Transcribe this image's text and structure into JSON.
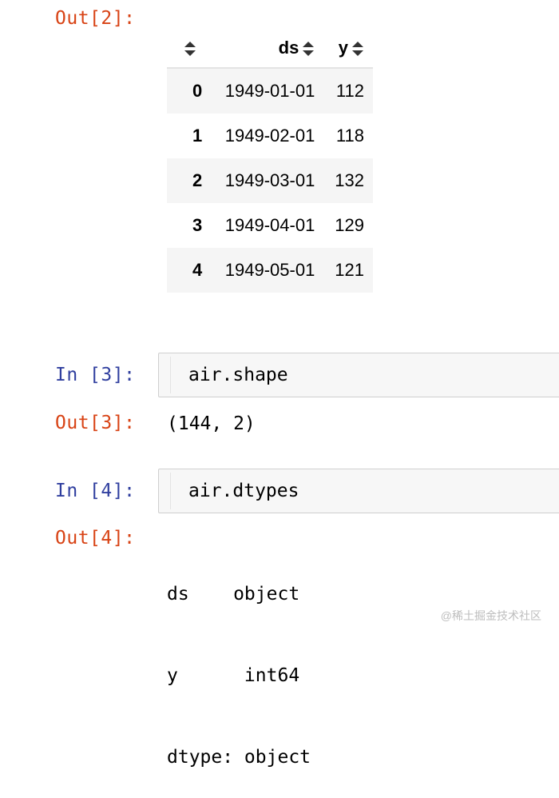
{
  "cells": {
    "out2": {
      "prompt": "Out[2]:",
      "table": {
        "columns": [
          "ds",
          "y"
        ],
        "rows": [
          {
            "index": "0",
            "ds": "1949-01-01",
            "y": "112"
          },
          {
            "index": "1",
            "ds": "1949-02-01",
            "y": "118"
          },
          {
            "index": "2",
            "ds": "1949-03-01",
            "y": "132"
          },
          {
            "index": "3",
            "ds": "1949-04-01",
            "y": "129"
          },
          {
            "index": "4",
            "ds": "1949-05-01",
            "y": "121"
          }
        ]
      }
    },
    "in3": {
      "prompt": "In [3]:",
      "code": "air.shape"
    },
    "out3": {
      "prompt": "Out[3]:",
      "text": "(144, 2)"
    },
    "in4": {
      "prompt": "In [4]:",
      "code": "air.dtypes"
    },
    "out4": {
      "prompt": "Out[4]:",
      "lines": [
        "ds    object",
        "y      int64",
        "dtype: object"
      ]
    }
  },
  "watermark": "@稀土掘金技术社区",
  "colors": {
    "out_prompt": "#d84315",
    "in_prompt": "#303f9f",
    "stripe": "#f5f5f5",
    "input_bg": "#f7f7f7"
  }
}
